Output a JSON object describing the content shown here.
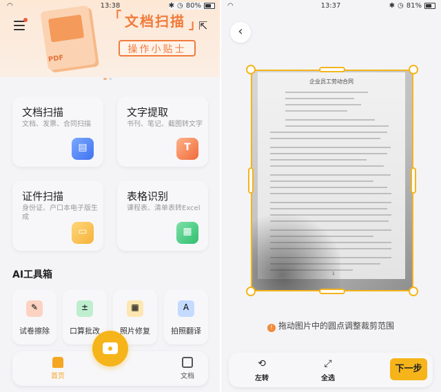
{
  "left_screen": {
    "status": {
      "time": "13:38",
      "battery": "80%",
      "battery_level": 0.8
    },
    "banner": {
      "title": "文档扫描",
      "button": "操作小贴士",
      "pdf_tag": "PDF"
    },
    "cards": [
      {
        "title": "文档扫描",
        "subtitle": "文档、发票、合同扫描",
        "icon": "document-scan-icon"
      },
      {
        "title": "文字提取",
        "subtitle": "书刊、笔记、截图转文字",
        "icon": "text-extract-icon",
        "glyph": "T"
      },
      {
        "title": "证件扫描",
        "subtitle": "身份证、户口本电子版生成",
        "icon": "id-card-icon"
      },
      {
        "title": "表格识别",
        "subtitle": "课程表、清单表转Excel",
        "icon": "table-icon"
      }
    ],
    "ai_title": "AI工具箱",
    "tools": [
      {
        "label": "试卷擦除",
        "icon": "eraser-icon",
        "glyph": "✎"
      },
      {
        "label": "口算批改",
        "icon": "calculator-icon",
        "glyph": "±"
      },
      {
        "label": "照片修复",
        "icon": "photo-repair-icon",
        "glyph": "▦"
      },
      {
        "label": "拍照翻译",
        "icon": "translate-icon",
        "glyph": "A"
      }
    ],
    "tabs": {
      "home": "首页",
      "docs": "文档"
    }
  },
  "right_screen": {
    "status": {
      "time": "13:37",
      "battery": "81%",
      "battery_level": 0.81
    },
    "document": {
      "title": "企业员工劳动合同",
      "page": "1"
    },
    "hint": "拖动图片中的圆点调整裁剪范围",
    "actions": {
      "rotate": "左转",
      "select_all": "全选",
      "next": "下一步"
    },
    "colors": {
      "accent": "#f5b41a",
      "brand_orange": "#f07a3a"
    }
  }
}
